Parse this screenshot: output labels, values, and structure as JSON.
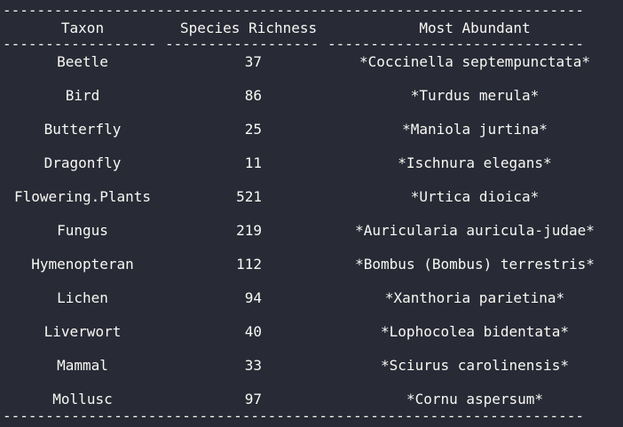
{
  "table": {
    "headers": {
      "taxon": "Taxon",
      "richness": "Species Richness",
      "abundant": "Most Abundant"
    },
    "rules": {
      "top": "--------------------------------------------------------------------",
      "header_sep": "------------------ ------------------ ------------------------------",
      "bottom": "--------------------------------------------------------------------"
    },
    "rows": [
      {
        "taxon": "Beetle",
        "richness": "37",
        "abundant": "*Coccinella septempunctata*"
      },
      {
        "taxon": "Bird",
        "richness": "86",
        "abundant": "*Turdus merula*"
      },
      {
        "taxon": "Butterfly",
        "richness": "25",
        "abundant": "*Maniola jurtina*"
      },
      {
        "taxon": "Dragonfly",
        "richness": "11",
        "abundant": "*Ischnura elegans*"
      },
      {
        "taxon": "Flowering.Plants",
        "richness": "521",
        "abundant": "*Urtica dioica*"
      },
      {
        "taxon": "Fungus",
        "richness": "219",
        "abundant": "*Auricularia auricula-judae*"
      },
      {
        "taxon": "Hymenopteran",
        "richness": "112",
        "abundant": "*Bombus (Bombus) terrestris*"
      },
      {
        "taxon": "Lichen",
        "richness": "94",
        "abundant": "*Xanthoria parietina*"
      },
      {
        "taxon": "Liverwort",
        "richness": "40",
        "abundant": "*Lophocolea bidentata*"
      },
      {
        "taxon": "Mammal",
        "richness": "33",
        "abundant": "*Sciurus carolinensis*"
      },
      {
        "taxon": "Mollusc",
        "richness": "97",
        "abundant": "*Cornu aspersum*"
      }
    ]
  }
}
